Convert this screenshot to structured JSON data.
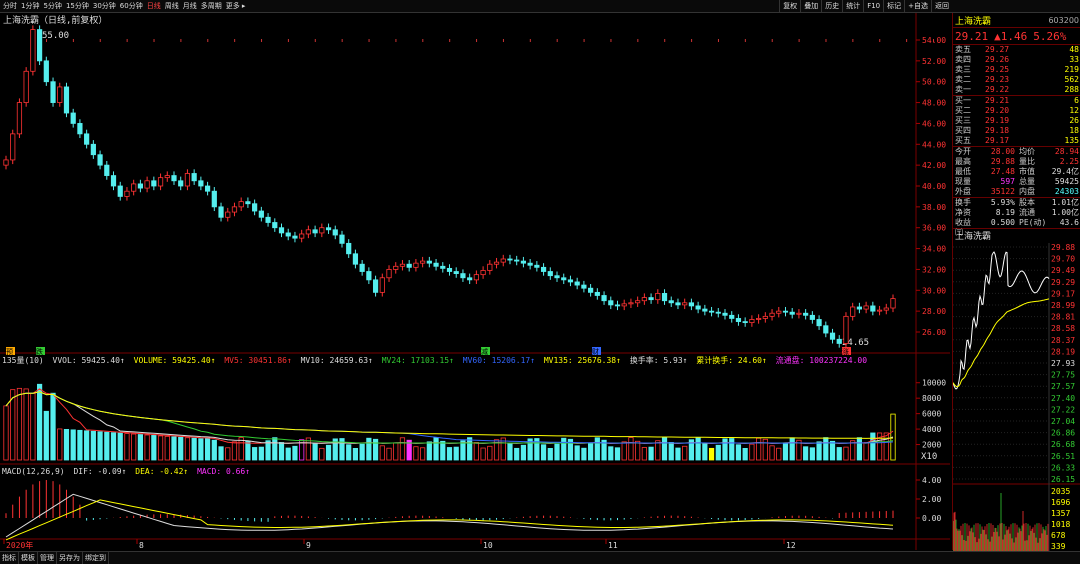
{
  "toolbar": {
    "periods": [
      "分时",
      "1分钟",
      "5分钟",
      "15分钟",
      "30分钟",
      "60分钟",
      "日线",
      "周线",
      "月线",
      "多周期",
      "更多 ▸"
    ],
    "active_period": "日线",
    "right_buttons": [
      "复权",
      "叠加",
      "历史",
      "统计",
      "F10",
      "标记",
      "+自选",
      "返回"
    ]
  },
  "chart": {
    "title": "上海洗霸（日线,前复权）",
    "high_label": "55.00",
    "low_label": "24.65",
    "price_ticks": [
      "54.00",
      "52.00",
      "50.00",
      "48.00",
      "46.00",
      "44.00",
      "42.00",
      "40.00",
      "38.00",
      "36.00",
      "34.00",
      "32.00",
      "30.00",
      "28.00",
      "26.00"
    ],
    "month_labels": [
      "2020年",
      "8",
      "9",
      "10",
      "11",
      "12"
    ],
    "markers": [
      "预",
      "跌",
      "减",
      "财",
      "涨"
    ],
    "volume_legend": {
      "prefix": "135量(10)",
      "vvol": "VVOL: 59425.40↑",
      "volume": "VOLUME: 59425.40↑",
      "mv5": "MV5: 30451.86↑",
      "mv10": "MV10: 24659.63↑",
      "mv24": "MV24: 17103.15↑",
      "mv60": "MV60: 15206.17↑",
      "mv135": "MV135: 25676.38↑",
      "turnover": "换手率: 5.93↑",
      "cum_turnover": "累计换手: 24.60↑",
      "float_cap": "流通盘: 100237224.00"
    },
    "volume_ticks": [
      "10000",
      "8000",
      "6000",
      "4000",
      "2000"
    ],
    "volume_unit": "X10",
    "macd_legend": {
      "prefix": "MACD(12,26,9)",
      "dif": "DIF: -0.09↑",
      "dea": "DEA: -0.42↑",
      "macd": "MACD: 0.66↑"
    },
    "macd_ticks": [
      "4.00",
      "2.00",
      "0.00"
    ]
  },
  "quote": {
    "name": "上海洗霸",
    "code": "603200",
    "price": "29.21",
    "change": "▲1.46",
    "pct": "5.26%",
    "asks": [
      {
        "label": "卖五",
        "price": "29.27",
        "vol": "48"
      },
      {
        "label": "卖四",
        "price": "29.26",
        "vol": "33"
      },
      {
        "label": "卖三",
        "price": "29.25",
        "vol": "219"
      },
      {
        "label": "卖二",
        "price": "29.23",
        "vol": "562"
      },
      {
        "label": "卖一",
        "price": "29.22",
        "vol": "288"
      }
    ],
    "bids": [
      {
        "label": "买一",
        "price": "29.21",
        "vol": "6"
      },
      {
        "label": "买二",
        "price": "29.20",
        "vol": "12"
      },
      {
        "label": "买三",
        "price": "29.19",
        "vol": "26"
      },
      {
        "label": "买四",
        "price": "29.18",
        "vol": "18"
      },
      {
        "label": "买五",
        "price": "29.17",
        "vol": "135"
      }
    ],
    "stats": [
      {
        "a": "今开",
        "b": "28.00",
        "bc": "red",
        "c": "均价",
        "d": "28.94",
        "dc": "red"
      },
      {
        "a": "最高",
        "b": "29.88",
        "bc": "red",
        "c": "量比",
        "d": "2.25",
        "dc": "red"
      },
      {
        "a": "最低",
        "b": "27.48",
        "bc": "red",
        "c": "市值",
        "d": "29.4亿",
        "dc": "wht"
      },
      {
        "a": "现量",
        "b": "597",
        "bc": "mag",
        "c": "总量",
        "d": "59425",
        "dc": "wht"
      },
      {
        "a": "外盘",
        "b": "35122",
        "bc": "red",
        "c": "内盘",
        "d": "24303",
        "dc": "cyan"
      }
    ],
    "stats2": [
      {
        "a": "换手",
        "b": "5.93%",
        "c": "股本",
        "d": "1.01亿"
      },
      {
        "a": "净资",
        "b": "8.19",
        "c": "流通",
        "d": "1.00亿"
      },
      {
        "a": "收益㈢",
        "b": "0.500",
        "c": "PE(动)",
        "d": "43.6"
      }
    ],
    "mini_chart_title": "上海洗霸",
    "mini_price_ticks": [
      "29.88",
      "29.70",
      "29.49",
      "29.29",
      "29.17",
      "28.99",
      "28.81",
      "28.58",
      "28.37",
      "28.19",
      "27.93",
      "27.75",
      "27.57",
      "27.40",
      "27.22",
      "27.04",
      "26.86",
      "26.68",
      "26.51",
      "26.33",
      "26.15"
    ],
    "mini_vol_ticks": [
      "2035",
      "1696",
      "1357",
      "1018",
      "678",
      "339"
    ],
    "mini_period": "日线"
  },
  "bottombar": [
    "指标",
    "模板",
    "管理",
    "另存为",
    "绑定到"
  ]
}
